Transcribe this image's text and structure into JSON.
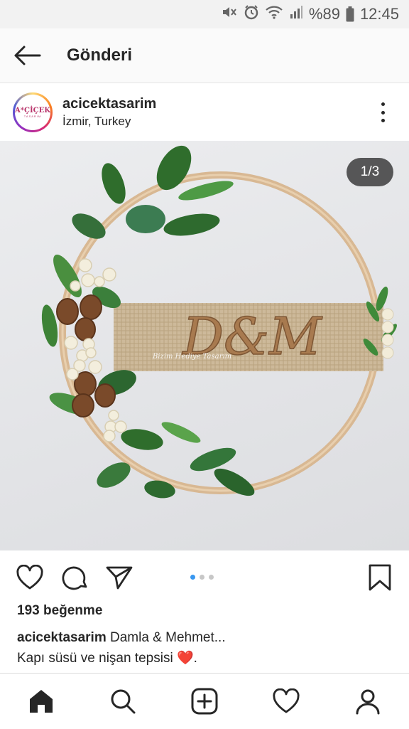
{
  "status_bar": {
    "battery_percent": "%89",
    "time": "12:45"
  },
  "header": {
    "title": "Gönderi"
  },
  "post": {
    "username": "acicektasarim",
    "location": "İzmir, Turkey",
    "avatar_logo": "A*ÇİÇEK",
    "avatar_sub": "TASARIM",
    "image_counter": "1/3",
    "likes": "193 beğenme",
    "caption_user": "acicektasarim",
    "caption_line1": "Damla & Mehmet...",
    "caption_line2": "Kapı süsü ve nişan tepsisi",
    "caption_emoji": "❤️",
    "caption_end": "."
  },
  "image_content": {
    "sign_text": "D&M",
    "watermark": "Bizim Hediye Tasarım"
  },
  "carousel": {
    "count": 3,
    "active": 0
  },
  "colors": {
    "accent": "#3897f0",
    "heart": "#e0245e",
    "text": "#262626"
  }
}
